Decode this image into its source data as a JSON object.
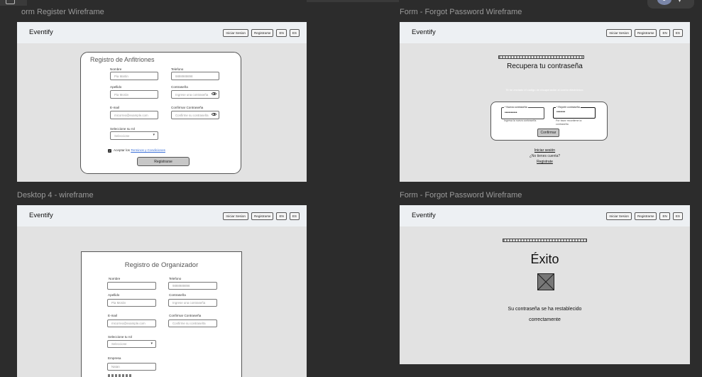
{
  "canvas": {
    "frames": [
      {
        "label": "orm Register Wireframe"
      },
      {
        "label": "Form - Forgot Password Wireframe"
      },
      {
        "label": "Desktop 4 - wireframe"
      },
      {
        "label": "Form - Forgot Password Wireframe"
      }
    ]
  },
  "nav": {
    "logo": "Eventify",
    "login": "Iniciar Sesion",
    "register": "Registrarse",
    "en": "EN",
    "es": "ES"
  },
  "host_form": {
    "title": "Registro de Anfitriones",
    "name_label": "Nombre",
    "name_placeholder": "Pia Martin",
    "phone_label": "Telefono",
    "phone_placeholder": "9898989898",
    "lastname_label": "Apellido",
    "lastname_placeholder": "Pia Morán",
    "password_label": "Contraseña",
    "password_placeholder": "Ingrese una contraseña",
    "email_label": "E-mail",
    "email_placeholder": "micorreo@example.com",
    "confirm_label": "Confirmar Contraseña",
    "confirm_placeholder": "Confirme su contraseña",
    "role_label": "Seleccione su rol",
    "role_value": "Seleccione",
    "terms_prefix": "Aceptar los ",
    "terms_link": "Terminos y Condiciones",
    "submit": "Registrarse"
  },
  "forgot": {
    "title": "Recupera tu contraseña",
    "hint": "Te he enviado el codigo de recuperación al correo electrónico.",
    "new_label": "* Nueva contraseña",
    "new_value": "••••••••••",
    "new_help": "Ingresa la nueva contraseña",
    "repeat_label": "* Repetir contraseña",
    "repeat_value": "•••••••",
    "repeat_help": "Por favor reconfirme la contraseña",
    "confirm": "Confirmar",
    "login_link": "Iniciar sesión",
    "no_account": "¿No tienes cuenta?",
    "register_link": "Registrate"
  },
  "org_form": {
    "title": "Registro de Organizador",
    "name_label": "Nombre",
    "phone_label": "Telefono",
    "phone_placeholder": "9898989898",
    "lastname_label": "Apellido",
    "lastname_placeholder": "Pia Morán",
    "password_label": "Contraseña",
    "password_placeholder": "Ingrese una contraseña",
    "email_label": "E-mail",
    "email_placeholder": "micorreo@example.com",
    "confirm_label": "Confirmar Contraseña",
    "confirm_placeholder": "Confirme su contraseña",
    "role_label": "Seleccione tu rol",
    "role_value": "Seleccione",
    "company_label": "Empresa",
    "company_placeholder": "Natan"
  },
  "success": {
    "title": "Éxito",
    "message_line1": "Su contraseña se ha restablecido",
    "message_line2": "correctamente"
  },
  "top": {
    "avatar_letter": "J"
  }
}
